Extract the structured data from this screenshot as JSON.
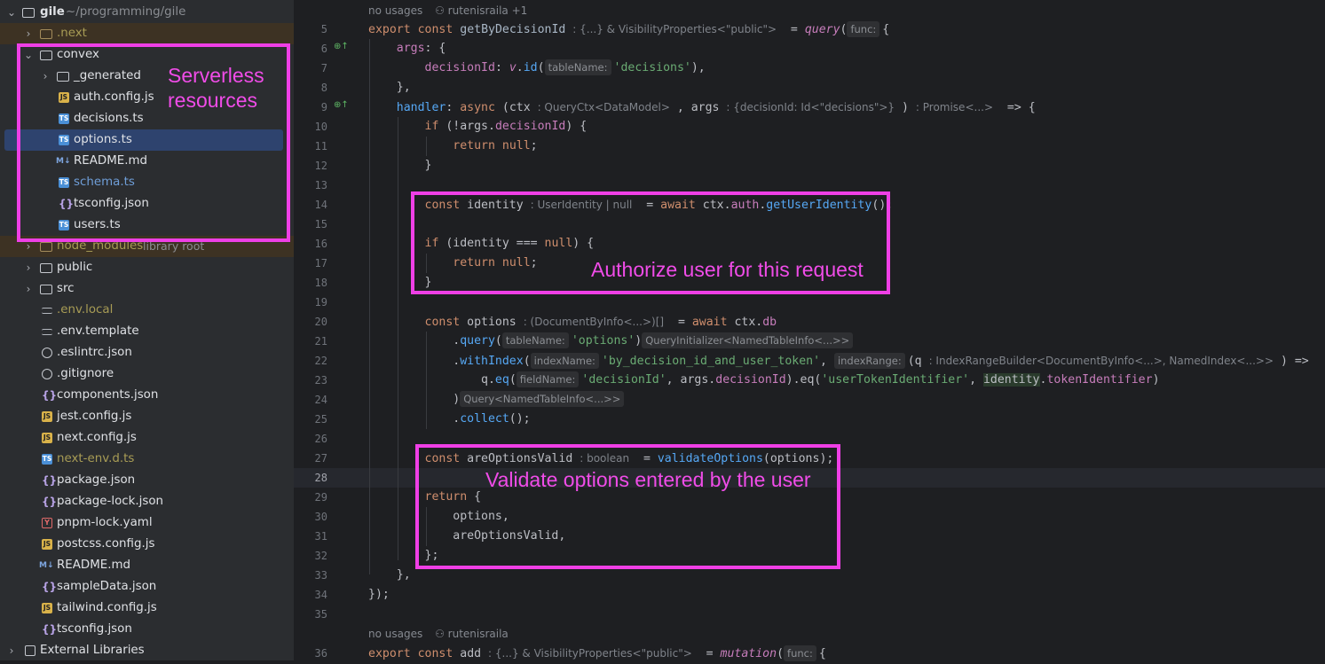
{
  "project": {
    "root_name": "gile",
    "root_path": "~/programming/gile",
    "items": [
      {
        "name": "folder-next",
        "label": ".next",
        "type": "folder",
        "expanded": false
      },
      {
        "name": "folder-convex",
        "label": "convex",
        "type": "folder",
        "expanded": true
      },
      {
        "name": "folder-generated",
        "label": "_generated",
        "type": "folder",
        "expanded": false
      },
      {
        "name": "file-auth-config",
        "label": "auth.config.js",
        "icon": "js"
      },
      {
        "name": "file-decisions",
        "label": "decisions.ts",
        "icon": "ts"
      },
      {
        "name": "file-options",
        "label": "options.ts",
        "icon": "ts",
        "selected": true
      },
      {
        "name": "file-readme-convex",
        "label": "README.md",
        "icon": "md"
      },
      {
        "name": "file-schema",
        "label": "schema.ts",
        "icon": "ts"
      },
      {
        "name": "file-tsconfig-convex",
        "label": "tsconfig.json",
        "icon": "json"
      },
      {
        "name": "file-users",
        "label": "users.ts",
        "icon": "ts"
      },
      {
        "name": "folder-node-modules",
        "label": "node_modules",
        "suffix": "library root",
        "type": "folder"
      },
      {
        "name": "folder-public",
        "label": "public",
        "type": "folder"
      },
      {
        "name": "folder-src",
        "label": "src",
        "type": "folder"
      },
      {
        "name": "file-env-local",
        "label": ".env.local",
        "icon": "env"
      },
      {
        "name": "file-env-template",
        "label": ".env.template",
        "icon": "env"
      },
      {
        "name": "file-eslintrc",
        "label": ".eslintrc.json",
        "icon": "circle"
      },
      {
        "name": "file-gitignore",
        "label": ".gitignore",
        "icon": "circle"
      },
      {
        "name": "file-components",
        "label": "components.json",
        "icon": "json"
      },
      {
        "name": "file-jest-config",
        "label": "jest.config.js",
        "icon": "js"
      },
      {
        "name": "file-next-config",
        "label": "next.config.js",
        "icon": "js"
      },
      {
        "name": "file-next-env",
        "label": "next-env.d.ts",
        "icon": "ts"
      },
      {
        "name": "file-package",
        "label": "package.json",
        "icon": "json"
      },
      {
        "name": "file-package-lock",
        "label": "package-lock.json",
        "icon": "json"
      },
      {
        "name": "file-pnpm-lock",
        "label": "pnpm-lock.yaml",
        "icon": "yaml"
      },
      {
        "name": "file-postcss-config",
        "label": "postcss.config.js",
        "icon": "js"
      },
      {
        "name": "file-readme-root",
        "label": "README.md",
        "icon": "md"
      },
      {
        "name": "file-sample-data",
        "label": "sampleData.json",
        "icon": "json"
      },
      {
        "name": "file-tailwind-config",
        "label": "tailwind.config.js",
        "icon": "js"
      },
      {
        "name": "file-tsconfig-root",
        "label": "tsconfig.json",
        "icon": "json"
      },
      {
        "name": "external-libraries",
        "label": "External Libraries",
        "icon": "libs"
      }
    ],
    "icon_labels": {
      "js": "JS",
      "ts": "TS",
      "md": "M↓",
      "json": "{}",
      "yaml": "Y"
    }
  },
  "editor": {
    "meta_top": {
      "usages": "no usages",
      "author": "rutenisraila +1"
    },
    "meta_bottom": {
      "usages": "no usages",
      "author": "rutenisraila"
    },
    "line_numbers": [
      "5",
      "6",
      "7",
      "8",
      "9",
      "10",
      "11",
      "12",
      "13",
      "14",
      "15",
      "16",
      "17",
      "18",
      "19",
      "20",
      "21",
      "22",
      "23",
      "24",
      "25",
      "26",
      "27",
      "28",
      "29",
      "30",
      "31",
      "32",
      "33",
      "34",
      "35",
      "36"
    ],
    "current_line": "28",
    "code": {
      "l5_export": "export",
      "l5_const": "const",
      "l5_name": "getByDecisionId",
      "l5_type": ": {...} & VisibilityProperties<\"public\">",
      "l5_query": "query",
      "l5_func_hint": "func:",
      "l6_args": "args",
      "l7_decisionId": "decisionId",
      "l7_v": "v",
      "l7_id": "id",
      "l7_hint": "tableName:",
      "l7_str": "'decisions'",
      "l9_handler": "handler",
      "l9_async": "async",
      "l9_ctx_type": ": QueryCtx<DataModel>",
      "l9_args_type": ": {decisionId: Id<\"decisions\">}",
      "l9_ret_type": ": Promise<...>",
      "l10_if": "if",
      "l10_decisionId": "decisionId",
      "l11_return": "return",
      "l11_null": "null",
      "l14_const": "const",
      "l14_type": ": UserIdentity | null",
      "l14_await": "await",
      "l14_auth": "auth",
      "l14_fn": "getUserIdentity",
      "l16_if": "if",
      "l16_null": "null",
      "l17_return": "return",
      "l17_null": "null",
      "l20_const": "const",
      "l20_type": ": (DocumentByInfo<...>)[]",
      "l20_await": "await",
      "l20_db": "db",
      "l21_query": "query",
      "l21_hint": "tableName:",
      "l21_str": "'options'",
      "l21_type": "QueryInitializer<NamedTableInfo<...>>",
      "l22_withIndex": "withIndex",
      "l22_hint1": "indexName:",
      "l22_str": "'by_decision_id_and_user_token'",
      "l22_hint2": "indexRange:",
      "l22_type": ": IndexRangeBuilder<DocumentByInfo<...>, NamedIndex<...>>",
      "l23_eq": "eq",
      "l23_hint": "fieldName:",
      "l23_str1": "'decisionId'",
      "l23_decisionId": "decisionId",
      "l23_str2": "'userTokenIdentifier'",
      "l23_identity": "identity",
      "l23_token": "tokenIdentifier",
      "l24_type": "Query<NamedTableInfo<...>>",
      "l25_collect": "collect",
      "l27_const": "const",
      "l27_type": ": boolean",
      "l27_fn": "validateOptions",
      "l29_return": "return",
      "l36_export": "export",
      "l36_const": "const",
      "l36_name": "add",
      "l36_type": ": {...} & VisibilityProperties<\"public\">",
      "l36_mutation": "mutation",
      "l36_func_hint": "func:"
    }
  },
  "annotations": [
    {
      "name": "annotation-serverless",
      "text": "Serverless\nresources",
      "line1": "Serverless",
      "line2": "resources"
    },
    {
      "name": "annotation-authorize",
      "text": "Authorize user for this request"
    },
    {
      "name": "annotation-validate",
      "text": "Validate options entered by the user"
    }
  ],
  "colors": {
    "annotation": "#ef3fe6",
    "selection": "#2e436e",
    "background": "#1e1f22",
    "sidebar": "#2b2d30"
  }
}
